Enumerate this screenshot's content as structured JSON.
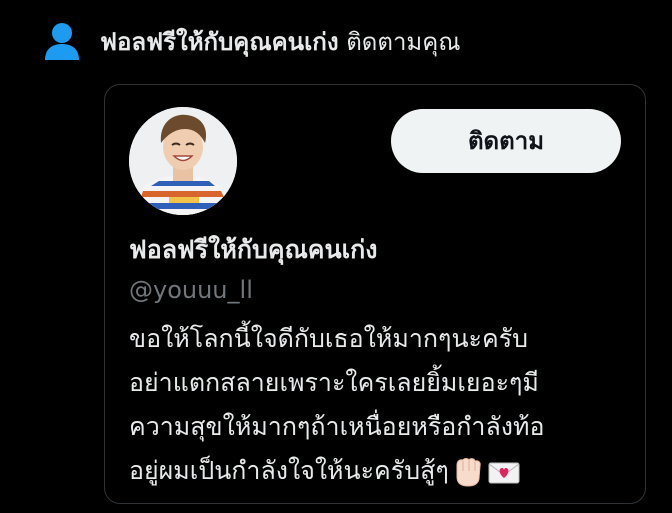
{
  "notification": {
    "icon": "person-icon",
    "icon_color": "#1d9bf0",
    "name": "ฟอลฟรีให้กับคุณคนเก่ง",
    "action": "ติดตามคุณ"
  },
  "card": {
    "follow_label": "ติดตาม",
    "display_name": "ฟอลฟรีให้กับคุณคนเก่ง",
    "handle": "@youuu_ll",
    "bio_lines": [
      "ขอให้โลกนี้ใจดีกับเธอให้มากๆนะครับ",
      "อย่าแตกสลายเพราะใครเลยยิ้มเยอะๆมี",
      "ความสุขให้มากๆถ้าเหนื่อยหรือกำลังท้อ",
      "อยู่ผมเป็นกำลังใจให้นะครับสู้ๆ"
    ],
    "bio_emojis": [
      "raised-fist-emoji",
      "love-letter-emoji"
    ]
  }
}
